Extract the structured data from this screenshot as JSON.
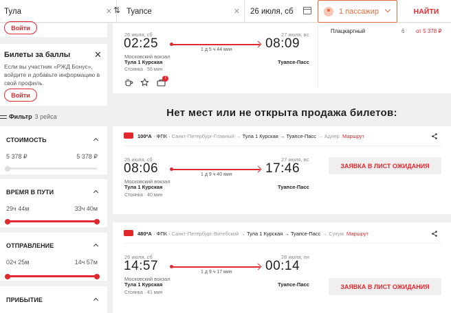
{
  "search": {
    "from": "Тула",
    "to": "Туапсе",
    "date": "26 июля, сб",
    "passengers": "1 пассажир",
    "find_label": "НАЙТИ"
  },
  "sidebar": {
    "login_label": "Войти",
    "bonus": {
      "title": "Билеты за баллы",
      "text": "Если вы участник «РЖД Бонус», войдите и добавьте информацию в свой профиль.",
      "login_label": "Войти"
    },
    "filter": {
      "label": "Фильтр",
      "count": "3 рейса"
    },
    "sections": [
      {
        "title": "СТОИМОСТЬ",
        "min": "5 378 ₽",
        "max": "5 378 ₽",
        "low": 0,
        "high": 1
      },
      {
        "title": "ВРЕМЯ В ПУТИ",
        "min": "29ч 44м",
        "max": "33ч 40м",
        "low": 0,
        "high": 1
      },
      {
        "title": "ОТПРАВЛЕНИЕ",
        "min": "02ч 25м",
        "max": "14ч 57м",
        "low": 0,
        "high": 1
      },
      {
        "title": "ПРИБЫТИЕ"
      }
    ]
  },
  "trains": [
    {
      "dep_date": "26 июля, сб",
      "dep_time": "02:25",
      "dep_station": "Московский вокзал",
      "dep_city": "Тула 1 Курская",
      "stop": "Стоянка · 56 мин",
      "arr_date": "27 июля, вс",
      "arr_time": "08:09",
      "arr_city": "Туапсе-Пасс",
      "duration": "1 д 5 ч 44 мин",
      "seat_type": "Плацкартный",
      "seat_count": "6",
      "seat_price": "от 5 378 ₽",
      "badge_count": "7"
    },
    {
      "number": "100*А",
      "carrier": "ФПК",
      "from": "Санкт-Петербург-Главный",
      "seg_from": "Тула 1 Курская",
      "seg_to": "Туапсе-Пасс",
      "to": "Адлер",
      "route_link": "Маршрут",
      "dep_date": "26 июля, сб",
      "dep_time": "08:06",
      "dep_station": "Московский вокзал",
      "dep_city": "Тула 1 Курская",
      "stop": "Стоянка · 40 мин",
      "arr_date": "27 июля, вс",
      "arr_time": "17:46",
      "arr_city": "Туапсе-Пасс",
      "duration": "1 д 9 ч 40 мин",
      "wait_label": "ЗАЯВКА В ЛИСТ ОЖИДАНИЯ"
    },
    {
      "number": "480*А",
      "carrier": "ФПК",
      "from": "Санкт-Петербург-Витебский",
      "seg_from": "Тула 1 Курская",
      "seg_to": "Туапсе-Пасс",
      "to": "Сухум",
      "route_link": "Маршрут",
      "dep_date": "26 июля, сб",
      "dep_time": "14:57",
      "dep_station": "Московский вокзал",
      "dep_city": "Тула 1 Курская",
      "stop": "Стоянка · 41 мин",
      "arr_date": "28 июля, пн",
      "arr_time": "00:14",
      "arr_city": "Туапсе-Пасс",
      "duration": "1 д 9 ч 17 мин",
      "wait_label": "ЗАЯВКА В ЛИСТ ОЖИДАНИЯ"
    }
  ],
  "no_seats_heading": "Нет мест или не открыта продажа билетов:",
  "colors": {
    "accent": "#e3282d",
    "orange": "#e16b3b",
    "background": "#eef0f2"
  }
}
